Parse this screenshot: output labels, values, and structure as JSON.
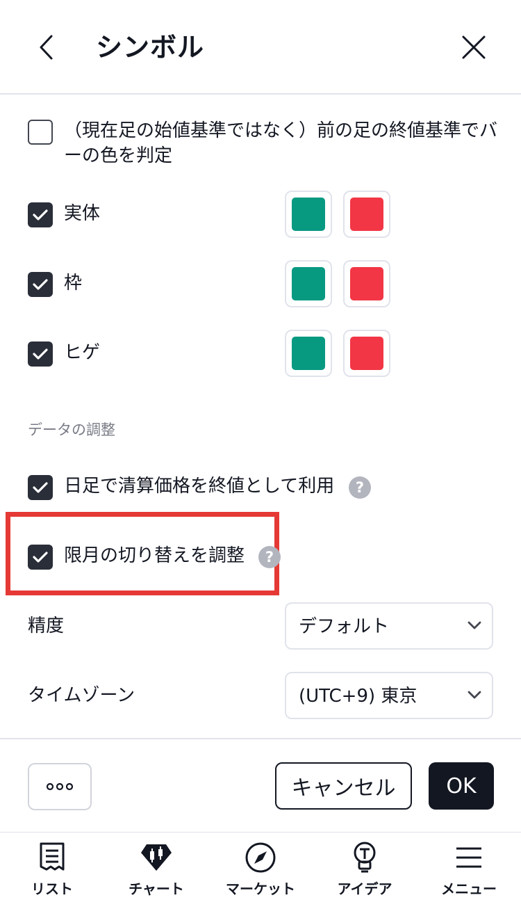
{
  "header": {
    "title": "シンボル"
  },
  "options": {
    "prev_close": {
      "label": "（現在足の始値基準ではなく）前の足の終値基準でバーの色を判定",
      "checked": false
    },
    "body": {
      "label": "実体",
      "checked": true,
      "up_color": "#089981",
      "down_color": "#f23645"
    },
    "borders": {
      "label": "枠",
      "checked": true,
      "up_color": "#089981",
      "down_color": "#f23645"
    },
    "wick": {
      "label": "ヒゲ",
      "checked": true,
      "up_color": "#089981",
      "down_color": "#f23645"
    }
  },
  "data_adjust": {
    "section_title": "データの調整",
    "settlement": {
      "label": "日足で清算価格を終値として利用",
      "checked": true
    },
    "contract_roll": {
      "label": "限月の切り替えを調整",
      "checked": true
    },
    "help_glyph": "?"
  },
  "precision": {
    "label": "精度",
    "value": "デフォルト"
  },
  "timezone": {
    "label": "タイムゾーン",
    "value": "(UTC+9) 東京"
  },
  "footer": {
    "more_label": "ooo",
    "cancel_label": "キャンセル",
    "ok_label": "OK"
  },
  "tabbar": {
    "items": [
      {
        "label": "リスト",
        "icon": "list-icon"
      },
      {
        "label": "チャート",
        "icon": "chart-icon"
      },
      {
        "label": "マーケット",
        "icon": "compass-icon"
      },
      {
        "label": "アイデア",
        "icon": "lightbulb-icon"
      },
      {
        "label": "メニュー",
        "icon": "menu-icon"
      }
    ]
  },
  "colors": {
    "highlight": "#e53935",
    "up": "#089981",
    "down": "#f23645",
    "accent": "#131722"
  }
}
